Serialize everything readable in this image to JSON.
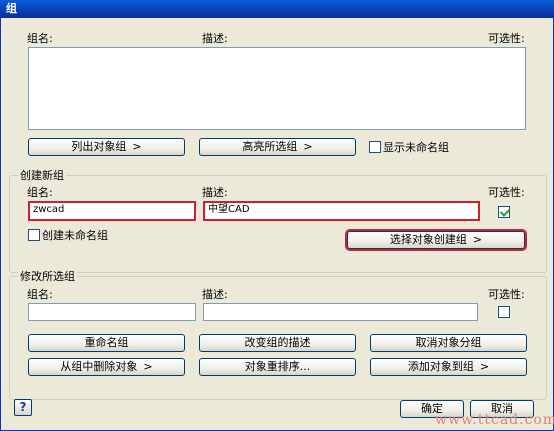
{
  "window": {
    "title": "组"
  },
  "groups_list": {
    "col_name": "组名:",
    "col_desc": "描述:",
    "col_select": "可选性:",
    "list_button": "列出对象组",
    "highlight_button": "高亮所选组",
    "show_unnamed_label": "显示未命名组",
    "arrow": ">"
  },
  "create": {
    "title": "创建新组",
    "name_label": "组名:",
    "desc_label": "描述:",
    "select_label": "可选性:",
    "name_value": "zwcad",
    "desc_value": "中望CAD",
    "selectable_checked": true,
    "unnamed_label": "创建未命名组",
    "select_create_button": "选择对象创建组"
  },
  "modify": {
    "title": "修改所选组",
    "name_label": "组名:",
    "desc_label": "描述:",
    "select_label": "可选性:",
    "name_value": "",
    "desc_value": "",
    "rename_button": "重命名组",
    "change_desc_button": "改变组的描述",
    "ungroup_button": "取消对象分组",
    "remove_button": "从组中删除对象",
    "reorder_button": "对象重排序...",
    "add_button": "添加对象到组"
  },
  "footer": {
    "help": "?",
    "ok": "确定",
    "cancel": "取消",
    "watermark": "www.ttcad.com"
  }
}
